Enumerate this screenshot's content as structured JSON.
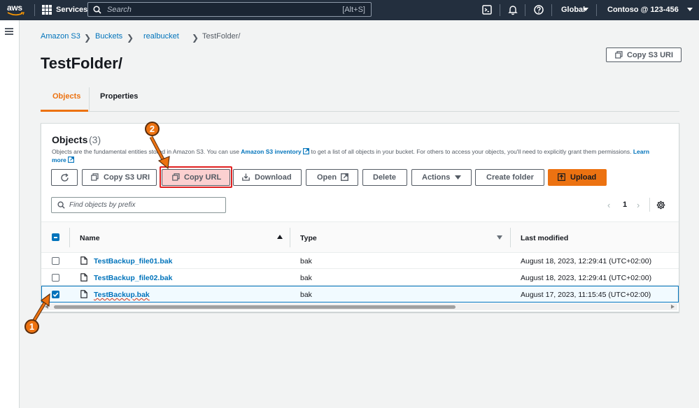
{
  "topnav": {
    "logo_text": "aws",
    "services_label": "Services",
    "search_placeholder": "Search",
    "search_shortcut": "[Alt+S]",
    "region": "Global",
    "account": "Contoso @ 123-456"
  },
  "breadcrumb": {
    "items": [
      "Amazon S3",
      "Buckets",
      "realbucket"
    ],
    "current": "TestFolder/"
  },
  "page": {
    "title": "TestFolder/",
    "copy_uri_label": "Copy S3 URI"
  },
  "tabs": [
    {
      "label": "Objects",
      "active": true
    },
    {
      "label": "Properties",
      "active": false
    }
  ],
  "objects_panel": {
    "title": "Objects",
    "count": "(3)",
    "description_pre": "Objects are the fundamental entities stored in Amazon S3. You can use ",
    "description_link": "Amazon S3 inventory",
    "description_post": " to get a list of all objects in your bucket. For others to access your objects, you'll need to explicitly grant them permissions.",
    "learn_more": "Learn more",
    "toolbar": {
      "copy_s3_uri": "Copy S3 URI",
      "copy_url": "Copy URL",
      "download": "Download",
      "open": "Open",
      "delete": "Delete",
      "actions": "Actions",
      "create_folder": "Create folder",
      "upload": "Upload"
    },
    "filter_placeholder": "Find objects by prefix",
    "pager": {
      "current_page": "1"
    }
  },
  "table": {
    "columns": [
      "Name",
      "Type",
      "Last modified"
    ],
    "rows": [
      {
        "name": "TestBackup_file01.bak",
        "type": "bak",
        "last_modified": "August 18, 2023, 12:29:41 (UTC+02:00)",
        "selected": false
      },
      {
        "name": "TestBackup_file02.bak",
        "type": "bak",
        "last_modified": "August 18, 2023, 12:29:41 (UTC+02:00)",
        "selected": false
      },
      {
        "name": "TestBackup.bak",
        "type": "bak",
        "last_modified": "August 17, 2023, 11:15:45 (UTC+02:00)",
        "selected": true
      }
    ]
  },
  "annotations": {
    "step1": "1",
    "step2": "2"
  },
  "colors": {
    "nav_bg": "#232f3e",
    "accent_orange": "#ec7211",
    "link_blue": "#0073bb",
    "highlight_red": "#e02020"
  }
}
